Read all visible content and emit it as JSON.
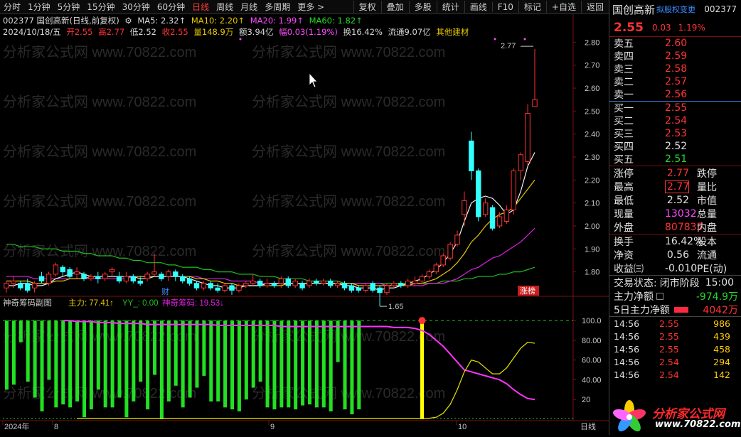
{
  "periods": [
    "分时",
    "1分钟",
    "5分钟",
    "15分钟",
    "30分钟",
    "60分钟",
    "日线",
    "周线",
    "月线",
    "多周期",
    "更多 >"
  ],
  "active_period": "日线",
  "tools": [
    "复权",
    "叠加",
    "多股",
    "统计",
    "画线",
    "F10",
    "标记",
    "+自选",
    "返回"
  ],
  "header": {
    "code_name": "002377 国创高新(日线,前复权)",
    "ma5": "MA5: 2.32↑",
    "ma10": "MA10: 2.20↑",
    "ma20": "MA20: 1.99↑",
    "ma60": "MA60: 1.82↑",
    "date": "2024/10/18/五",
    "open": "开2.55",
    "high": "高2.77",
    "low": "低2.52",
    "close": "收2.55",
    "vol": "量148.9万",
    "amount": "额3.94亿",
    "range": "幅0.03(1.19%)",
    "turnover": "换16.42%",
    "float": "流通9.07亿",
    "sector": "其他建材"
  },
  "watermark": "分析家公式网 www.70822.com",
  "chart_data": [
    {
      "type": "candlestick",
      "title": "002377 国创高新(日线,前复权)",
      "y_ticks": [
        "2.80",
        "2.70",
        "2.60",
        "2.50",
        "2.40",
        "2.30",
        "2.20",
        "2.10",
        "2.00",
        "1.90",
        "1.80"
      ],
      "ylim": [
        1.74,
        2.86
      ],
      "x_ticks": [
        "2024年",
        "8",
        "9",
        "10"
      ],
      "annotations": {
        "max_label": "2.77",
        "min_label": "1.65",
        "finance_marker": "财",
        "limit_up_marker": "涨榜"
      },
      "candles": [
        {
          "o": 1.73,
          "c": 1.75,
          "h": 1.76,
          "l": 1.71
        },
        {
          "o": 1.75,
          "c": 1.76,
          "h": 1.78,
          "l": 1.73
        },
        {
          "o": 1.75,
          "c": 1.73,
          "h": 1.76,
          "l": 1.72
        },
        {
          "o": 1.75,
          "c": 1.72,
          "h": 1.77,
          "l": 1.71
        },
        {
          "o": 1.73,
          "c": 1.75,
          "h": 1.76,
          "l": 1.71
        },
        {
          "o": 1.78,
          "c": 1.76,
          "h": 1.8,
          "l": 1.75
        },
        {
          "o": 1.75,
          "c": 1.79,
          "h": 1.8,
          "l": 1.74
        },
        {
          "o": 1.79,
          "c": 1.83,
          "h": 1.84,
          "l": 1.78
        },
        {
          "o": 1.82,
          "c": 1.8,
          "h": 1.83,
          "l": 1.78
        },
        {
          "o": 1.81,
          "c": 1.78,
          "h": 1.82,
          "l": 1.77
        },
        {
          "o": 1.79,
          "c": 1.8,
          "h": 1.82,
          "l": 1.77
        },
        {
          "o": 1.79,
          "c": 1.77,
          "h": 1.8,
          "l": 1.76
        },
        {
          "o": 1.77,
          "c": 1.78,
          "h": 1.79,
          "l": 1.76
        },
        {
          "o": 1.78,
          "c": 1.77,
          "h": 1.8,
          "l": 1.75
        },
        {
          "o": 1.77,
          "c": 1.79,
          "h": 1.8,
          "l": 1.76
        },
        {
          "o": 1.8,
          "c": 1.81,
          "h": 1.82,
          "l": 1.78
        },
        {
          "o": 1.78,
          "c": 1.76,
          "h": 1.8,
          "l": 1.75
        },
        {
          "o": 1.76,
          "c": 1.78,
          "h": 1.8,
          "l": 1.75
        },
        {
          "o": 1.78,
          "c": 1.76,
          "h": 1.79,
          "l": 1.75
        },
        {
          "o": 1.76,
          "c": 1.75,
          "h": 1.78,
          "l": 1.74
        },
        {
          "o": 1.77,
          "c": 1.79,
          "h": 1.8,
          "l": 1.76
        },
        {
          "o": 1.79,
          "c": 1.8,
          "h": 1.88,
          "l": 1.78
        },
        {
          "o": 1.79,
          "c": 1.77,
          "h": 1.8,
          "l": 1.76
        },
        {
          "o": 1.78,
          "c": 1.8,
          "h": 1.81,
          "l": 1.76
        },
        {
          "o": 1.8,
          "c": 1.78,
          "h": 1.81,
          "l": 1.76
        },
        {
          "o": 1.78,
          "c": 1.76,
          "h": 1.79,
          "l": 1.75
        },
        {
          "o": 1.77,
          "c": 1.75,
          "h": 1.78,
          "l": 1.74
        },
        {
          "o": 1.75,
          "c": 1.73,
          "h": 1.76,
          "l": 1.72
        },
        {
          "o": 1.73,
          "c": 1.75,
          "h": 1.76,
          "l": 1.72
        },
        {
          "o": 1.75,
          "c": 1.73,
          "h": 1.76,
          "l": 1.72
        },
        {
          "o": 1.73,
          "c": 1.72,
          "h": 1.75,
          "l": 1.71
        },
        {
          "o": 1.72,
          "c": 1.74,
          "h": 1.75,
          "l": 1.71
        },
        {
          "o": 1.74,
          "c": 1.72,
          "h": 1.75,
          "l": 1.7
        },
        {
          "o": 1.72,
          "c": 1.74,
          "h": 1.75,
          "l": 1.71
        },
        {
          "o": 1.74,
          "c": 1.75,
          "h": 1.76,
          "l": 1.73
        },
        {
          "o": 1.75,
          "c": 1.76,
          "h": 1.79,
          "l": 1.74
        },
        {
          "o": 1.76,
          "c": 1.74,
          "h": 1.77,
          "l": 1.73
        },
        {
          "o": 1.74,
          "c": 1.75,
          "h": 1.77,
          "l": 1.73
        },
        {
          "o": 1.75,
          "c": 1.74,
          "h": 1.76,
          "l": 1.73
        },
        {
          "o": 1.75,
          "c": 1.77,
          "h": 1.78,
          "l": 1.73
        },
        {
          "o": 1.77,
          "c": 1.74,
          "h": 1.78,
          "l": 1.73
        },
        {
          "o": 1.74,
          "c": 1.76,
          "h": 1.77,
          "l": 1.73
        },
        {
          "o": 1.75,
          "c": 1.73,
          "h": 1.76,
          "l": 1.72
        },
        {
          "o": 1.74,
          "c": 1.76,
          "h": 1.77,
          "l": 1.73
        },
        {
          "o": 1.76,
          "c": 1.75,
          "h": 1.77,
          "l": 1.74
        },
        {
          "o": 1.75,
          "c": 1.76,
          "h": 1.77,
          "l": 1.74
        },
        {
          "o": 1.76,
          "c": 1.74,
          "h": 1.77,
          "l": 1.73
        },
        {
          "o": 1.74,
          "c": 1.75,
          "h": 1.76,
          "l": 1.73
        },
        {
          "o": 1.75,
          "c": 1.73,
          "h": 1.76,
          "l": 1.72
        },
        {
          "o": 1.74,
          "c": 1.72,
          "h": 1.75,
          "l": 1.71
        },
        {
          "o": 1.73,
          "c": 1.72,
          "h": 1.74,
          "l": 1.71
        },
        {
          "o": 1.72,
          "c": 1.74,
          "h": 1.75,
          "l": 1.71
        },
        {
          "o": 1.75,
          "c": 1.72,
          "h": 1.76,
          "l": 1.71
        },
        {
          "o": 1.73,
          "c": 1.71,
          "h": 1.74,
          "l": 1.65
        },
        {
          "o": 1.71,
          "c": 1.74,
          "h": 1.75,
          "l": 1.7
        },
        {
          "o": 1.74,
          "c": 1.75,
          "h": 1.76,
          "l": 1.73
        },
        {
          "o": 1.75,
          "c": 1.74,
          "h": 1.76,
          "l": 1.73
        },
        {
          "o": 1.74,
          "c": 1.76,
          "h": 1.77,
          "l": 1.73
        },
        {
          "o": 1.75,
          "c": 1.76,
          "h": 1.78,
          "l": 1.74
        },
        {
          "o": 1.76,
          "c": 1.78,
          "h": 1.79,
          "l": 1.75
        },
        {
          "o": 1.78,
          "c": 1.8,
          "h": 1.81,
          "l": 1.77
        },
        {
          "o": 1.8,
          "c": 1.83,
          "h": 1.84,
          "l": 1.79
        },
        {
          "o": 1.83,
          "c": 1.87,
          "h": 1.88,
          "l": 1.82
        },
        {
          "o": 1.86,
          "c": 1.92,
          "h": 1.93,
          "l": 1.85
        },
        {
          "o": 1.92,
          "c": 1.96,
          "h": 1.98,
          "l": 1.91
        },
        {
          "o": 2.05,
          "c": 2.11,
          "h": 2.15,
          "l": 2.0
        },
        {
          "o": 2.37,
          "c": 2.24,
          "h": 2.41,
          "l": 2.2
        },
        {
          "o": 2.24,
          "c": 2.04,
          "h": 2.25,
          "l": 2.02
        },
        {
          "o": 2.05,
          "c": 2.1,
          "h": 2.12,
          "l": 2.04
        },
        {
          "o": 2.08,
          "c": 1.99,
          "h": 2.09,
          "l": 1.98
        },
        {
          "o": 2.0,
          "c": 2.04,
          "h": 2.06,
          "l": 1.99
        },
        {
          "o": 2.02,
          "c": 2.07,
          "h": 2.09,
          "l": 2.01
        },
        {
          "o": 2.07,
          "c": 2.24,
          "h": 2.25,
          "l": 2.05
        },
        {
          "o": 2.24,
          "c": 2.31,
          "h": 2.32,
          "l": 2.2
        },
        {
          "o": 2.28,
          "c": 2.49,
          "h": 2.53,
          "l": 2.26
        },
        {
          "o": 2.52,
          "c": 2.55,
          "h": 2.77,
          "l": 2.52
        }
      ],
      "ma5": [
        1.74,
        1.74,
        1.75,
        1.75,
        1.74,
        1.74,
        1.75,
        1.77,
        1.78,
        1.79,
        1.8,
        1.79,
        1.78,
        1.78,
        1.78,
        1.78,
        1.78,
        1.78,
        1.78,
        1.77,
        1.77,
        1.78,
        1.78,
        1.78,
        1.78,
        1.78,
        1.77,
        1.76,
        1.75,
        1.74,
        1.74,
        1.73,
        1.73,
        1.73,
        1.74,
        1.74,
        1.74,
        1.75,
        1.75,
        1.75,
        1.75,
        1.75,
        1.75,
        1.75,
        1.75,
        1.75,
        1.75,
        1.75,
        1.74,
        1.74,
        1.73,
        1.73,
        1.73,
        1.72,
        1.73,
        1.73,
        1.74,
        1.75,
        1.76,
        1.77,
        1.79,
        1.81,
        1.84,
        1.88,
        1.93,
        2.02,
        2.1,
        2.12,
        2.13,
        2.12,
        2.09,
        2.05,
        2.07,
        2.15,
        2.26,
        2.32
      ],
      "ma10": [
        1.76,
        1.76,
        1.76,
        1.76,
        1.75,
        1.75,
        1.75,
        1.76,
        1.76,
        1.77,
        1.77,
        1.77,
        1.78,
        1.78,
        1.78,
        1.78,
        1.78,
        1.78,
        1.78,
        1.78,
        1.78,
        1.78,
        1.78,
        1.78,
        1.78,
        1.78,
        1.78,
        1.77,
        1.77,
        1.76,
        1.76,
        1.75,
        1.75,
        1.74,
        1.74,
        1.74,
        1.74,
        1.74,
        1.74,
        1.74,
        1.75,
        1.75,
        1.75,
        1.75,
        1.75,
        1.75,
        1.75,
        1.75,
        1.75,
        1.75,
        1.74,
        1.74,
        1.74,
        1.74,
        1.74,
        1.74,
        1.74,
        1.74,
        1.75,
        1.75,
        1.76,
        1.77,
        1.79,
        1.81,
        1.84,
        1.88,
        1.93,
        1.96,
        2.0,
        2.03,
        2.05,
        2.06,
        2.08,
        2.12,
        2.16,
        2.2
      ],
      "ma20": [
        1.78,
        1.78,
        1.78,
        1.78,
        1.77,
        1.77,
        1.77,
        1.77,
        1.77,
        1.77,
        1.77,
        1.77,
        1.77,
        1.77,
        1.77,
        1.77,
        1.77,
        1.77,
        1.78,
        1.78,
        1.78,
        1.78,
        1.78,
        1.78,
        1.78,
        1.78,
        1.78,
        1.78,
        1.77,
        1.77,
        1.77,
        1.77,
        1.76,
        1.76,
        1.76,
        1.76,
        1.75,
        1.75,
        1.75,
        1.75,
        1.75,
        1.75,
        1.75,
        1.75,
        1.75,
        1.75,
        1.75,
        1.75,
        1.75,
        1.75,
        1.75,
        1.75,
        1.75,
        1.75,
        1.74,
        1.74,
        1.74,
        1.74,
        1.74,
        1.74,
        1.75,
        1.75,
        1.75,
        1.76,
        1.77,
        1.79,
        1.81,
        1.82,
        1.84,
        1.86,
        1.87,
        1.89,
        1.91,
        1.93,
        1.96,
        1.99
      ],
      "ma60": [
        1.92,
        1.92,
        1.91,
        1.91,
        1.91,
        1.9,
        1.9,
        1.9,
        1.89,
        1.89,
        1.89,
        1.88,
        1.88,
        1.87,
        1.87,
        1.87,
        1.86,
        1.86,
        1.85,
        1.85,
        1.84,
        1.84,
        1.84,
        1.83,
        1.83,
        1.82,
        1.82,
        1.82,
        1.81,
        1.81,
        1.8,
        1.8,
        1.8,
        1.79,
        1.79,
        1.79,
        1.78,
        1.78,
        1.78,
        1.77,
        1.77,
        1.77,
        1.77,
        1.76,
        1.76,
        1.76,
        1.76,
        1.76,
        1.75,
        1.75,
        1.75,
        1.75,
        1.75,
        1.75,
        1.75,
        1.75,
        1.75,
        1.75,
        1.75,
        1.75,
        1.75,
        1.75,
        1.76,
        1.76,
        1.76,
        1.77,
        1.77,
        1.78,
        1.78,
        1.78,
        1.79,
        1.79,
        1.8,
        1.8,
        1.81,
        1.82
      ]
    },
    {
      "type": "bar",
      "title": "神奇筹码副图",
      "legend": {
        "zhuli": "主力: 77.41↑",
        "yy": "YY_: 0.00",
        "chouma": "神奇筹码: 19.53↓"
      },
      "y_ticks": [
        "100.0",
        "80.00",
        "60.00",
        "40.00",
        "20"
      ],
      "ylim": [
        0,
        108
      ],
      "green_bars": [
        70,
        65,
        22,
        62,
        78,
        92,
        60,
        88,
        85,
        88,
        82,
        98,
        90,
        70,
        88,
        88,
        78,
        98,
        82,
        62,
        90,
        55,
        100,
        82,
        66,
        88,
        78,
        68,
        56,
        82,
        82,
        88,
        90,
        92,
        80,
        68,
        62,
        88,
        90,
        88,
        88,
        90,
        86,
        85,
        88,
        88,
        92,
        42,
        90,
        95,
        90
      ],
      "yellow_bar_value": 100,
      "chouma_series": [
        100,
        100,
        99,
        99,
        99,
        98,
        98,
        98,
        97,
        97,
        97,
        97,
        96,
        96,
        96,
        96,
        96,
        96,
        96,
        96,
        96,
        96,
        95,
        95,
        95,
        95,
        95,
        95,
        95,
        95,
        95,
        94,
        94,
        94,
        94,
        94,
        94,
        94,
        94,
        94,
        94,
        94,
        94,
        94,
        94,
        94,
        94,
        93,
        93,
        93,
        92,
        90,
        86,
        80,
        74,
        66,
        58,
        50,
        48,
        46,
        44,
        42,
        40,
        36,
        30,
        25,
        21,
        20
      ],
      "zhuli_series": [
        1,
        1,
        1,
        1,
        1,
        1,
        1,
        1,
        1,
        1,
        1,
        1,
        1,
        1,
        1,
        1,
        1,
        1,
        1,
        1,
        1,
        1,
        1,
        1,
        1,
        1,
        1,
        1,
        1,
        1,
        1,
        1,
        1,
        1,
        1,
        1,
        1,
        1,
        1,
        1,
        1,
        1,
        1,
        1,
        1,
        1,
        1,
        1,
        1,
        1,
        1,
        2,
        6,
        15,
        30,
        48,
        60,
        58,
        52,
        46,
        46,
        52,
        62,
        72,
        78,
        77
      ]
    }
  ],
  "right_panel": {
    "name": "国创高新",
    "fq_label": "拟股权变更",
    "code": "002377",
    "price": "2.55",
    "change": "0.03",
    "pct": "1.19%",
    "sells": [
      {
        "label": "卖五",
        "price": "2.60"
      },
      {
        "label": "卖四",
        "price": "2.59"
      },
      {
        "label": "卖三",
        "price": "2.58"
      },
      {
        "label": "卖二",
        "price": "2.57"
      },
      {
        "label": "卖一",
        "price": "2.56"
      }
    ],
    "buys": [
      {
        "label": "买一",
        "price": "2.55",
        "color": "#ff3333"
      },
      {
        "label": "买二",
        "price": "2.54",
        "color": "#ff3333"
      },
      {
        "label": "买三",
        "price": "2.53",
        "color": "#ff3333"
      },
      {
        "label": "买四",
        "price": "2.52",
        "color": "#e0e0e0"
      },
      {
        "label": "买五",
        "price": "2.51",
        "color": "#29d629"
      }
    ],
    "q1": [
      {
        "l1": "涨停",
        "v1": "2.77",
        "c": "#ff3333",
        "l2": "跌停"
      },
      {
        "l1": "最高",
        "v1": "2.77",
        "c": "#ff3333",
        "l2": "量比",
        "boxed": true
      },
      {
        "l1": "最低",
        "v1": "2.52",
        "c": "#e0e0e0",
        "l2": "市值"
      },
      {
        "l1": "现量",
        "v1": "13032",
        "c": "#ff4cff",
        "l2": "总量"
      },
      {
        "l1": "外盘",
        "v1": "807835",
        "c": "#ff3333",
        "l2": "内盘"
      }
    ],
    "q2": [
      {
        "l1": "换手",
        "v1": "16.42%",
        "c": "#e0e0e0",
        "l2": "股本"
      },
      {
        "l1": "净资",
        "v1": "0.56",
        "c": "#e0e0e0",
        "l2": "流通"
      },
      {
        "l1": "收益㈢",
        "v1": "-0.010",
        "c": "#e0e0e0",
        "l2": "PE(动)"
      }
    ],
    "status_label": "交易状态:",
    "status_value": "闭市阶段",
    "status_time": "15:00",
    "flow1_label": "主力净额",
    "flow1_value": "-974.9万",
    "flow2_label": "5日主力净额",
    "flow2_value": "4042万",
    "ticks": [
      {
        "t": "14:56",
        "p": "2.55",
        "v": "986"
      },
      {
        "t": "14:56",
        "p": "2.55",
        "v": "439"
      },
      {
        "t": "14:56",
        "p": "2.55",
        "v": "458"
      },
      {
        "t": "14:56",
        "p": "2.54",
        "v": "294"
      },
      {
        "t": "14:56",
        "p": "2.54",
        "v": "142"
      }
    ],
    "logo_text": "分析家公式网",
    "logo_url": "www.70822.com"
  },
  "bottom_right_label": "日线"
}
